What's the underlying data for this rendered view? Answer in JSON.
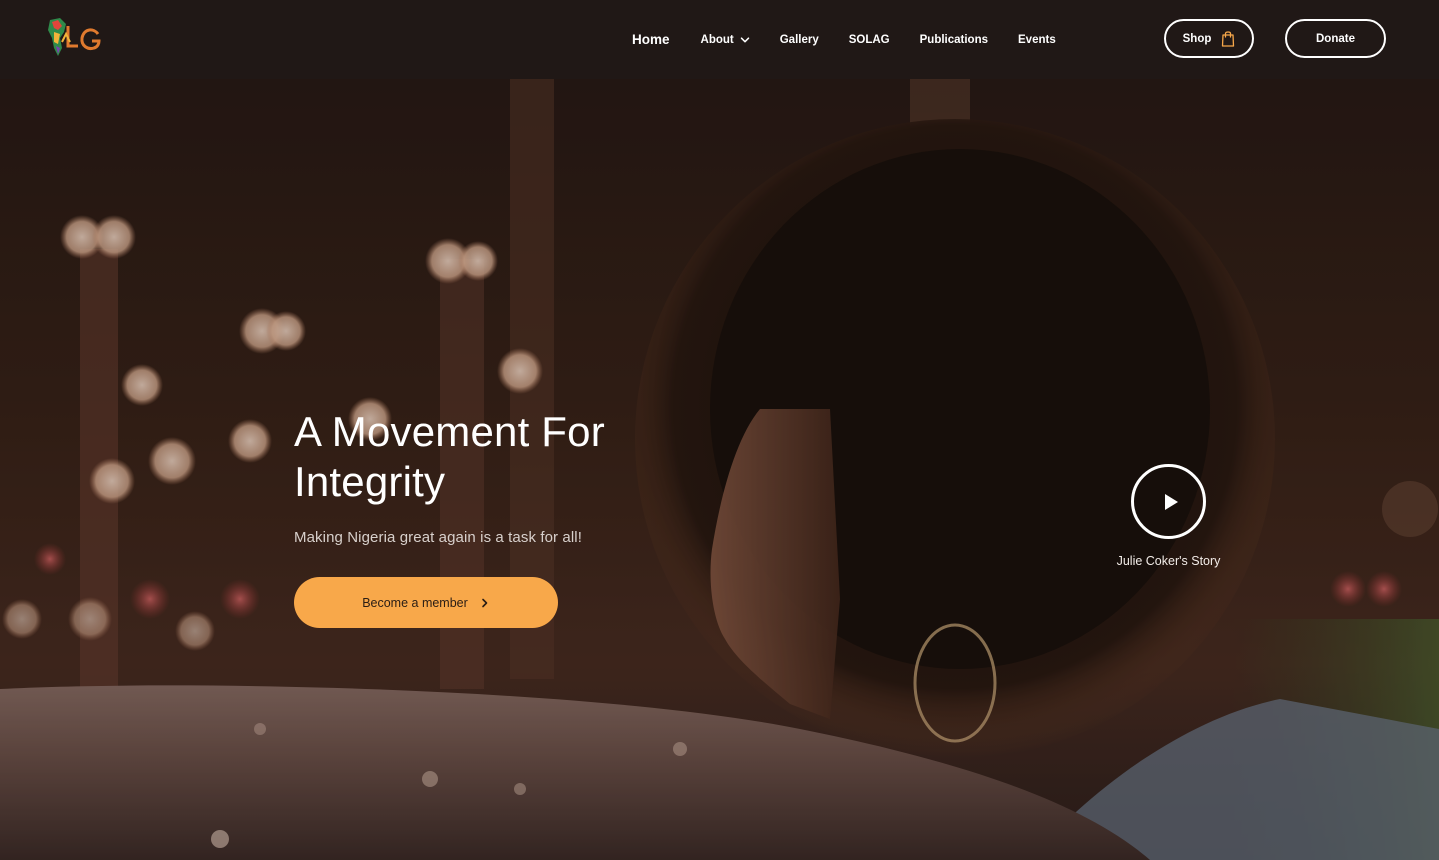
{
  "brand": {
    "logo_text": "ALG",
    "accent": "#f8a84a"
  },
  "nav": {
    "items": [
      {
        "label": "Home"
      },
      {
        "label": "About"
      },
      {
        "label": "Gallery"
      },
      {
        "label": "SOLAG"
      },
      {
        "label": "Publications"
      },
      {
        "label": "Events"
      }
    ],
    "shop_label": "Shop",
    "donate_label": "Donate"
  },
  "hero": {
    "headline_line1": "A Movement For",
    "headline_line2": "Integrity",
    "subheadline": "Making Nigeria great again is a task for all!",
    "cta_label": "Become a member",
    "video_label": "Julie Coker's Story"
  },
  "colors": {
    "header_bg": "#201816",
    "cta_bg": "#f8a84a",
    "text": "#ffffff"
  }
}
